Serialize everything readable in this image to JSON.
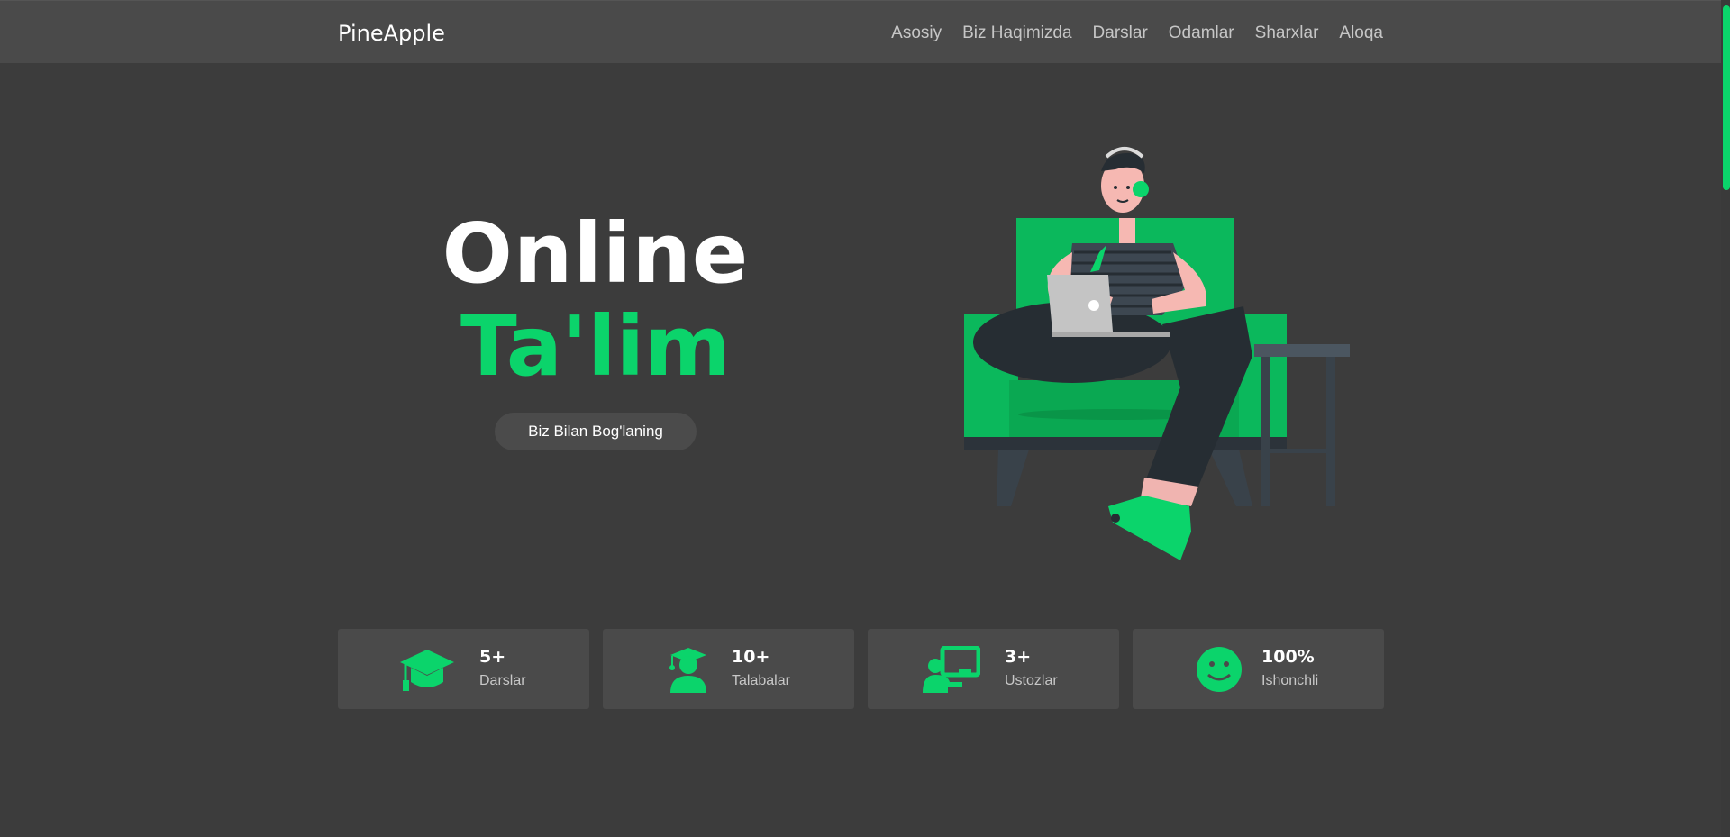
{
  "navbar": {
    "brand": "PineApple",
    "links": [
      {
        "label": "Asosiy"
      },
      {
        "label": "Biz Haqimizda"
      },
      {
        "label": "Darslar"
      },
      {
        "label": "Odamlar"
      },
      {
        "label": "Sharxlar"
      },
      {
        "label": "Aloqa"
      }
    ]
  },
  "hero": {
    "title": "Online",
    "subtitle": "Ta'lim",
    "cta_label": "Biz Bilan Bog'laning",
    "illustration": "person-on-sofa-with-laptop"
  },
  "stats": [
    {
      "value": "5+",
      "label": "Darslar",
      "icon": "graduation-cap-icon"
    },
    {
      "value": "10+",
      "label": "Talabalar",
      "icon": "student-icon"
    },
    {
      "value": "3+",
      "label": "Ustozlar",
      "icon": "teacher-icon"
    },
    {
      "value": "100%",
      "label": "Ishonchli",
      "icon": "smile-icon"
    }
  ],
  "colors": {
    "background": "#3c3c3c",
    "navbar": "#4a4a4a",
    "accent": "#0bd46b",
    "card": "#4a4a4a"
  }
}
